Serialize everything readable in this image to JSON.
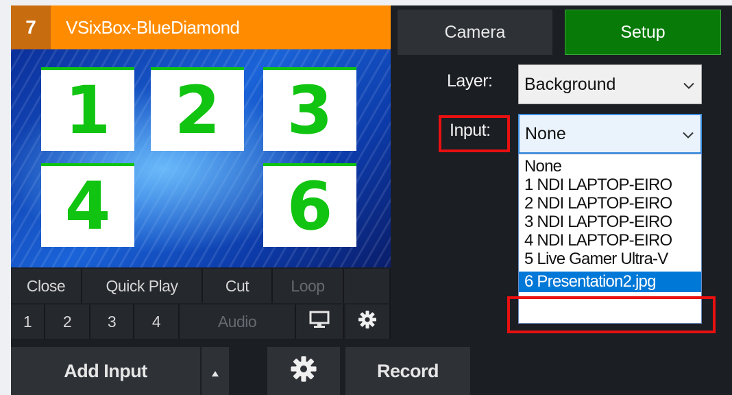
{
  "input": {
    "number": "7",
    "title": "VSixBox-BlueDiamond"
  },
  "preview": {
    "tiles": [
      "1",
      "2",
      "3",
      "4",
      "6"
    ]
  },
  "controls": {
    "row1": [
      "Close",
      "Quick Play",
      "Cut",
      "Loop"
    ],
    "row2": [
      "1",
      "2",
      "3",
      "4",
      "Audio"
    ]
  },
  "toolbar": {
    "add_input": "Add Input",
    "record": "Record"
  },
  "tabs": {
    "camera": "Camera",
    "setup": "Setup"
  },
  "layer": {
    "label": "Layer:",
    "value": "Background"
  },
  "input_field": {
    "label": "Input:",
    "value": "None"
  },
  "dropdown_options": [
    "None",
    "1 NDI LAPTOP-EIRO",
    "2 NDI LAPTOP-EIRO",
    "3 NDI LAPTOP-EIRO",
    "4 NDI LAPTOP-EIRO",
    "5 Live Gamer Ultra-V",
    "6 Presentation2.jpg"
  ],
  "colors": {
    "title_bar": "#ff8c00",
    "setup_button": "#087a08",
    "tile_digit": "#11c411",
    "highlight_box": "#e81010",
    "selection": "#0078d7"
  }
}
